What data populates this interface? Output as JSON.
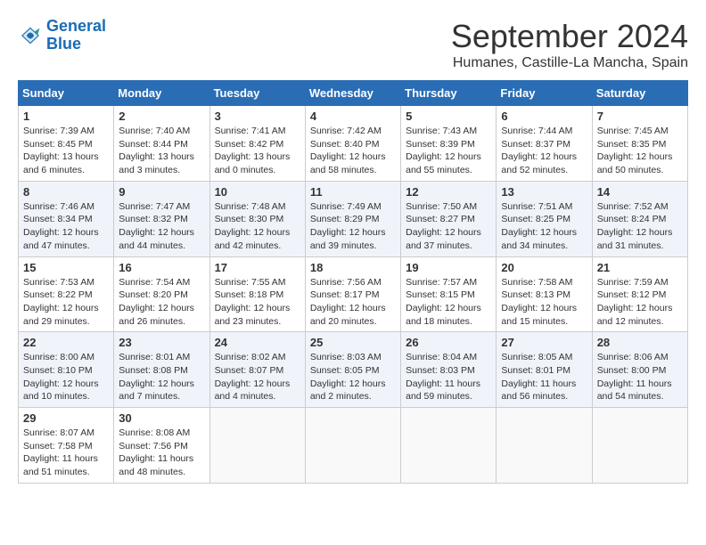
{
  "logo": {
    "line1": "General",
    "line2": "Blue"
  },
  "title": "September 2024",
  "subtitle": "Humanes, Castille-La Mancha, Spain",
  "days_header": [
    "Sunday",
    "Monday",
    "Tuesday",
    "Wednesday",
    "Thursday",
    "Friday",
    "Saturday"
  ],
  "weeks": [
    [
      {
        "day": "1",
        "info": "Sunrise: 7:39 AM\nSunset: 8:45 PM\nDaylight: 13 hours\nand 6 minutes."
      },
      {
        "day": "2",
        "info": "Sunrise: 7:40 AM\nSunset: 8:44 PM\nDaylight: 13 hours\nand 3 minutes."
      },
      {
        "day": "3",
        "info": "Sunrise: 7:41 AM\nSunset: 8:42 PM\nDaylight: 13 hours\nand 0 minutes."
      },
      {
        "day": "4",
        "info": "Sunrise: 7:42 AM\nSunset: 8:40 PM\nDaylight: 12 hours\nand 58 minutes."
      },
      {
        "day": "5",
        "info": "Sunrise: 7:43 AM\nSunset: 8:39 PM\nDaylight: 12 hours\nand 55 minutes."
      },
      {
        "day": "6",
        "info": "Sunrise: 7:44 AM\nSunset: 8:37 PM\nDaylight: 12 hours\nand 52 minutes."
      },
      {
        "day": "7",
        "info": "Sunrise: 7:45 AM\nSunset: 8:35 PM\nDaylight: 12 hours\nand 50 minutes."
      }
    ],
    [
      {
        "day": "8",
        "info": "Sunrise: 7:46 AM\nSunset: 8:34 PM\nDaylight: 12 hours\nand 47 minutes."
      },
      {
        "day": "9",
        "info": "Sunrise: 7:47 AM\nSunset: 8:32 PM\nDaylight: 12 hours\nand 44 minutes."
      },
      {
        "day": "10",
        "info": "Sunrise: 7:48 AM\nSunset: 8:30 PM\nDaylight: 12 hours\nand 42 minutes."
      },
      {
        "day": "11",
        "info": "Sunrise: 7:49 AM\nSunset: 8:29 PM\nDaylight: 12 hours\nand 39 minutes."
      },
      {
        "day": "12",
        "info": "Sunrise: 7:50 AM\nSunset: 8:27 PM\nDaylight: 12 hours\nand 37 minutes."
      },
      {
        "day": "13",
        "info": "Sunrise: 7:51 AM\nSunset: 8:25 PM\nDaylight: 12 hours\nand 34 minutes."
      },
      {
        "day": "14",
        "info": "Sunrise: 7:52 AM\nSunset: 8:24 PM\nDaylight: 12 hours\nand 31 minutes."
      }
    ],
    [
      {
        "day": "15",
        "info": "Sunrise: 7:53 AM\nSunset: 8:22 PM\nDaylight: 12 hours\nand 29 minutes."
      },
      {
        "day": "16",
        "info": "Sunrise: 7:54 AM\nSunset: 8:20 PM\nDaylight: 12 hours\nand 26 minutes."
      },
      {
        "day": "17",
        "info": "Sunrise: 7:55 AM\nSunset: 8:18 PM\nDaylight: 12 hours\nand 23 minutes."
      },
      {
        "day": "18",
        "info": "Sunrise: 7:56 AM\nSunset: 8:17 PM\nDaylight: 12 hours\nand 20 minutes."
      },
      {
        "day": "19",
        "info": "Sunrise: 7:57 AM\nSunset: 8:15 PM\nDaylight: 12 hours\nand 18 minutes."
      },
      {
        "day": "20",
        "info": "Sunrise: 7:58 AM\nSunset: 8:13 PM\nDaylight: 12 hours\nand 15 minutes."
      },
      {
        "day": "21",
        "info": "Sunrise: 7:59 AM\nSunset: 8:12 PM\nDaylight: 12 hours\nand 12 minutes."
      }
    ],
    [
      {
        "day": "22",
        "info": "Sunrise: 8:00 AM\nSunset: 8:10 PM\nDaylight: 12 hours\nand 10 minutes."
      },
      {
        "day": "23",
        "info": "Sunrise: 8:01 AM\nSunset: 8:08 PM\nDaylight: 12 hours\nand 7 minutes."
      },
      {
        "day": "24",
        "info": "Sunrise: 8:02 AM\nSunset: 8:07 PM\nDaylight: 12 hours\nand 4 minutes."
      },
      {
        "day": "25",
        "info": "Sunrise: 8:03 AM\nSunset: 8:05 PM\nDaylight: 12 hours\nand 2 minutes."
      },
      {
        "day": "26",
        "info": "Sunrise: 8:04 AM\nSunset: 8:03 PM\nDaylight: 11 hours\nand 59 minutes."
      },
      {
        "day": "27",
        "info": "Sunrise: 8:05 AM\nSunset: 8:01 PM\nDaylight: 11 hours\nand 56 minutes."
      },
      {
        "day": "28",
        "info": "Sunrise: 8:06 AM\nSunset: 8:00 PM\nDaylight: 11 hours\nand 54 minutes."
      }
    ],
    [
      {
        "day": "29",
        "info": "Sunrise: 8:07 AM\nSunset: 7:58 PM\nDaylight: 11 hours\nand 51 minutes."
      },
      {
        "day": "30",
        "info": "Sunrise: 8:08 AM\nSunset: 7:56 PM\nDaylight: 11 hours\nand 48 minutes."
      },
      {
        "day": "",
        "info": ""
      },
      {
        "day": "",
        "info": ""
      },
      {
        "day": "",
        "info": ""
      },
      {
        "day": "",
        "info": ""
      },
      {
        "day": "",
        "info": ""
      }
    ]
  ]
}
